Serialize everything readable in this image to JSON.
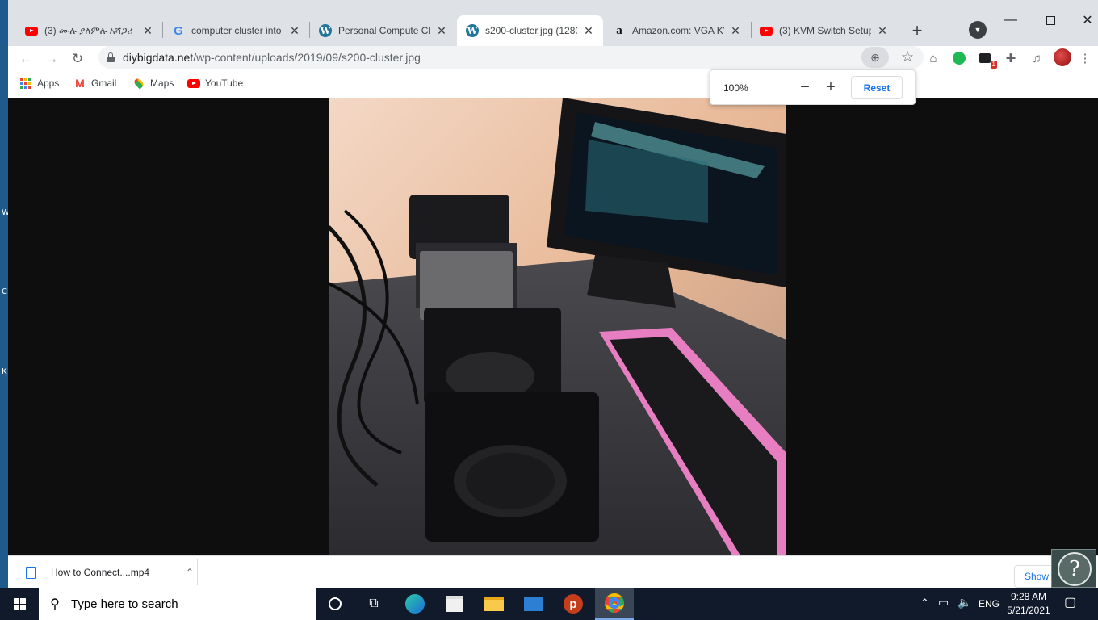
{
  "desktop": {
    "side_letters": [
      "W",
      "C",
      "K"
    ]
  },
  "tabs": [
    {
      "title": "(3) ሙሉ ያለምሉ አሻጋሪ • ",
      "icon": "youtube-icon",
      "active": false
    },
    {
      "title": "computer cluster into",
      "icon": "google-icon",
      "active": false
    },
    {
      "title": "Personal Compute Clu",
      "icon": "wordpress-icon",
      "active": false
    },
    {
      "title": "s200-cluster.jpg (1280",
      "icon": "wordpress-icon",
      "active": true
    },
    {
      "title": "Amazon.com: VGA KV",
      "icon": "amazon-icon",
      "active": false
    },
    {
      "title": "(3) KVM Switch Setup",
      "icon": "youtube-icon",
      "active": false
    }
  ],
  "omnibox": {
    "domain": "diybigdata.net",
    "path": "/wp-content/uploads/2019/09/s200-cluster.jpg"
  },
  "bookmarks": [
    {
      "label": "Apps",
      "icon": "apps-grid-icon"
    },
    {
      "label": "Gmail",
      "icon": "gmail-icon"
    },
    {
      "label": "Maps",
      "icon": "maps-icon"
    },
    {
      "label": "YouTube",
      "icon": "youtube-icon"
    }
  ],
  "zoom_popup": {
    "level": "100%",
    "minus": "−",
    "plus": "+",
    "reset_label": "Reset"
  },
  "download": {
    "filename": "How to Connect....mp4",
    "show_all": "Show"
  },
  "taskbar": {
    "search_placeholder": "Type here to search",
    "lang": "ENG",
    "time": "9:28 AM",
    "date": "5/21/2021"
  },
  "ext_badge": "1",
  "colors": {
    "accent": "#1a73e8",
    "tabstrip": "#dee1e6",
    "taskbar": "#101a2b"
  }
}
